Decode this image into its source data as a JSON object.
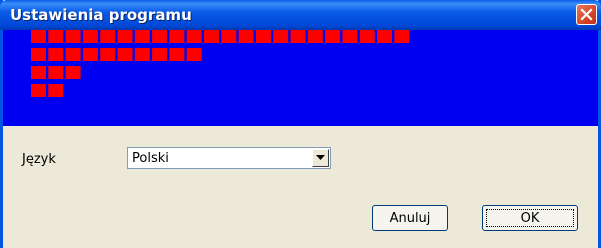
{
  "window": {
    "title": "Ustawienia programu",
    "close_icon": "close-icon"
  },
  "banner": {
    "background_color": "#0000f0",
    "block_color": "#ff0000",
    "row_block_counts": [
      22,
      10,
      3,
      2
    ]
  },
  "settings": {
    "language_label": "Język",
    "language_selected": "Polski"
  },
  "buttons": {
    "cancel_label": "Anuluj",
    "ok_label": "OK"
  }
}
